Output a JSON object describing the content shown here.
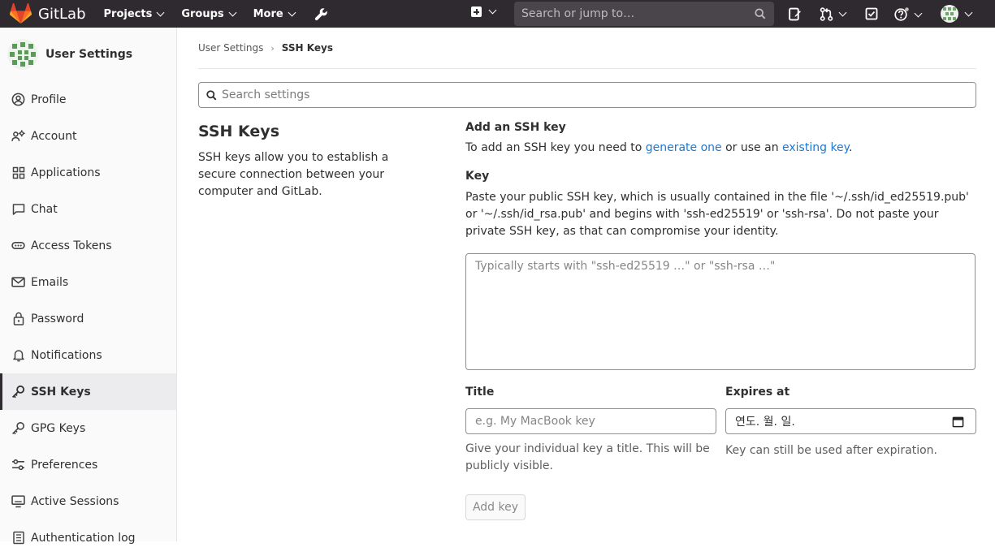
{
  "navbar": {
    "brand": "GitLab",
    "menu": [
      {
        "label": "Projects"
      },
      {
        "label": "Groups"
      },
      {
        "label": "More"
      }
    ],
    "search_placeholder": "Search or jump to…"
  },
  "sidebar": {
    "title": "User Settings",
    "items": [
      {
        "label": "Profile",
        "icon": "profile-icon"
      },
      {
        "label": "Account",
        "icon": "account-icon"
      },
      {
        "label": "Applications",
        "icon": "applications-icon"
      },
      {
        "label": "Chat",
        "icon": "chat-icon"
      },
      {
        "label": "Access Tokens",
        "icon": "token-icon"
      },
      {
        "label": "Emails",
        "icon": "mail-icon"
      },
      {
        "label": "Password",
        "icon": "lock-icon"
      },
      {
        "label": "Notifications",
        "icon": "bell-icon"
      },
      {
        "label": "SSH Keys",
        "icon": "key-icon",
        "active": true
      },
      {
        "label": "GPG Keys",
        "icon": "key-icon"
      },
      {
        "label": "Preferences",
        "icon": "preferences-icon"
      },
      {
        "label": "Active Sessions",
        "icon": "monitor-icon"
      },
      {
        "label": "Authentication log",
        "icon": "log-icon"
      }
    ]
  },
  "breadcrumb": {
    "parent": "User Settings",
    "current": "SSH Keys"
  },
  "settings_search_placeholder": "Search settings",
  "section": {
    "title": "SSH Keys",
    "description": "SSH keys allow you to establish a secure connection between your computer and GitLab."
  },
  "form": {
    "heading": "Add an SSH key",
    "intro_prefix": "To add an SSH key you need to ",
    "intro_link1": "generate one",
    "intro_middle": " or use an ",
    "intro_link2": "existing key",
    "intro_suffix": ".",
    "key_label": "Key",
    "key_help": "Paste your public SSH key, which is usually contained in the file '~/.ssh/id_ed25519.pub' or '~/.ssh/id_rsa.pub' and begins with 'ssh-ed25519' or 'ssh-rsa'. Do not paste your private SSH key, as that can compromise your identity.",
    "key_placeholder": "Typically starts with \"ssh-ed25519 …\" or \"ssh-rsa …\"",
    "title_label": "Title",
    "title_placeholder": "e.g. My MacBook key",
    "title_help": "Give your individual key a title. This will be publicly visible.",
    "expires_label": "Expires at",
    "expires_value": "연도. 월. 일.",
    "expires_help": "Key can still be used after expiration.",
    "submit_label": "Add key"
  },
  "colors": {
    "navbar_bg": "#2f2a2f",
    "link": "#1f78d1",
    "logo_orange": "#fc6d26"
  }
}
